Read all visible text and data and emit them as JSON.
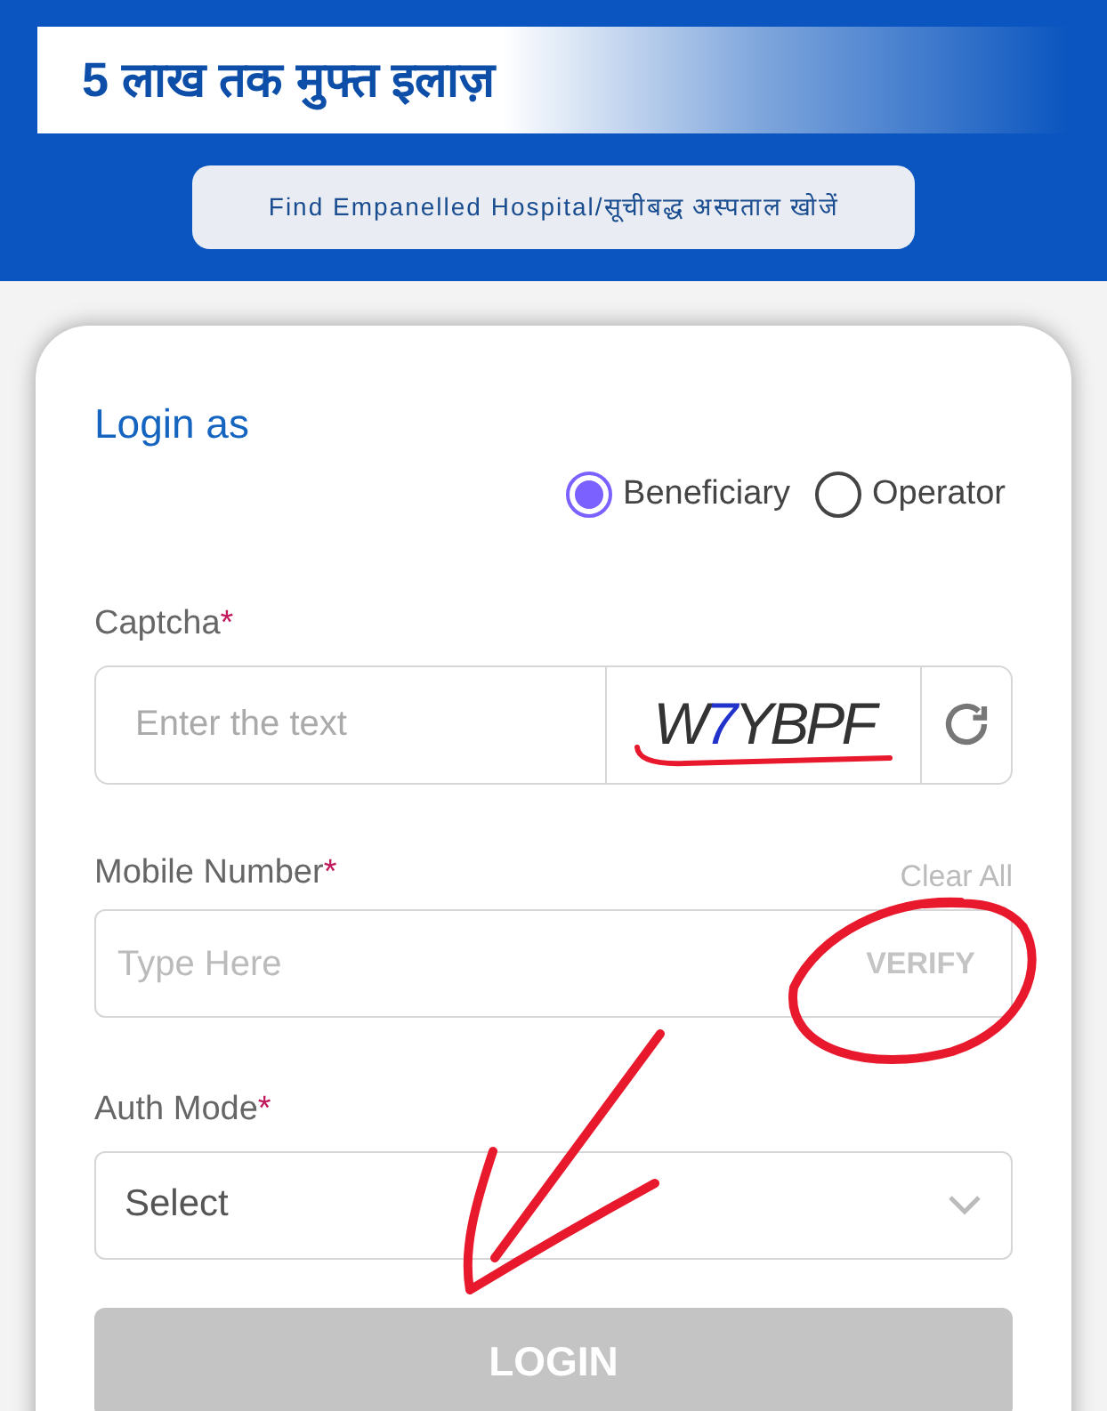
{
  "banner": {
    "title": "5 लाख तक मुफ्त इलाज़"
  },
  "hospital_button": {
    "label": "Find Empanelled Hospital/सूचीबद्ध अस्पताल खोजें"
  },
  "login": {
    "heading": "Login as",
    "roles": [
      {
        "label": "Beneficiary",
        "selected": true
      },
      {
        "label": "Operator",
        "selected": false
      }
    ],
    "captcha": {
      "label": "Captcha",
      "required_mark": "*",
      "placeholder": "Enter the text",
      "image_text": [
        {
          "text": "W",
          "color": "#333333"
        },
        {
          "text": "7",
          "color": "#2233cc"
        },
        {
          "text": "YBPF",
          "color": "#333333"
        }
      ]
    },
    "mobile": {
      "label": "Mobile Number",
      "required_mark": "*",
      "clear": "Clear All",
      "placeholder": "Type Here",
      "action": "VERIFY",
      "action_disabled": true
    },
    "auth_mode": {
      "label": "Auth Mode",
      "required_mark": "*",
      "value": "Select"
    },
    "submit": {
      "label": "LOGIN",
      "disabled": true
    }
  }
}
